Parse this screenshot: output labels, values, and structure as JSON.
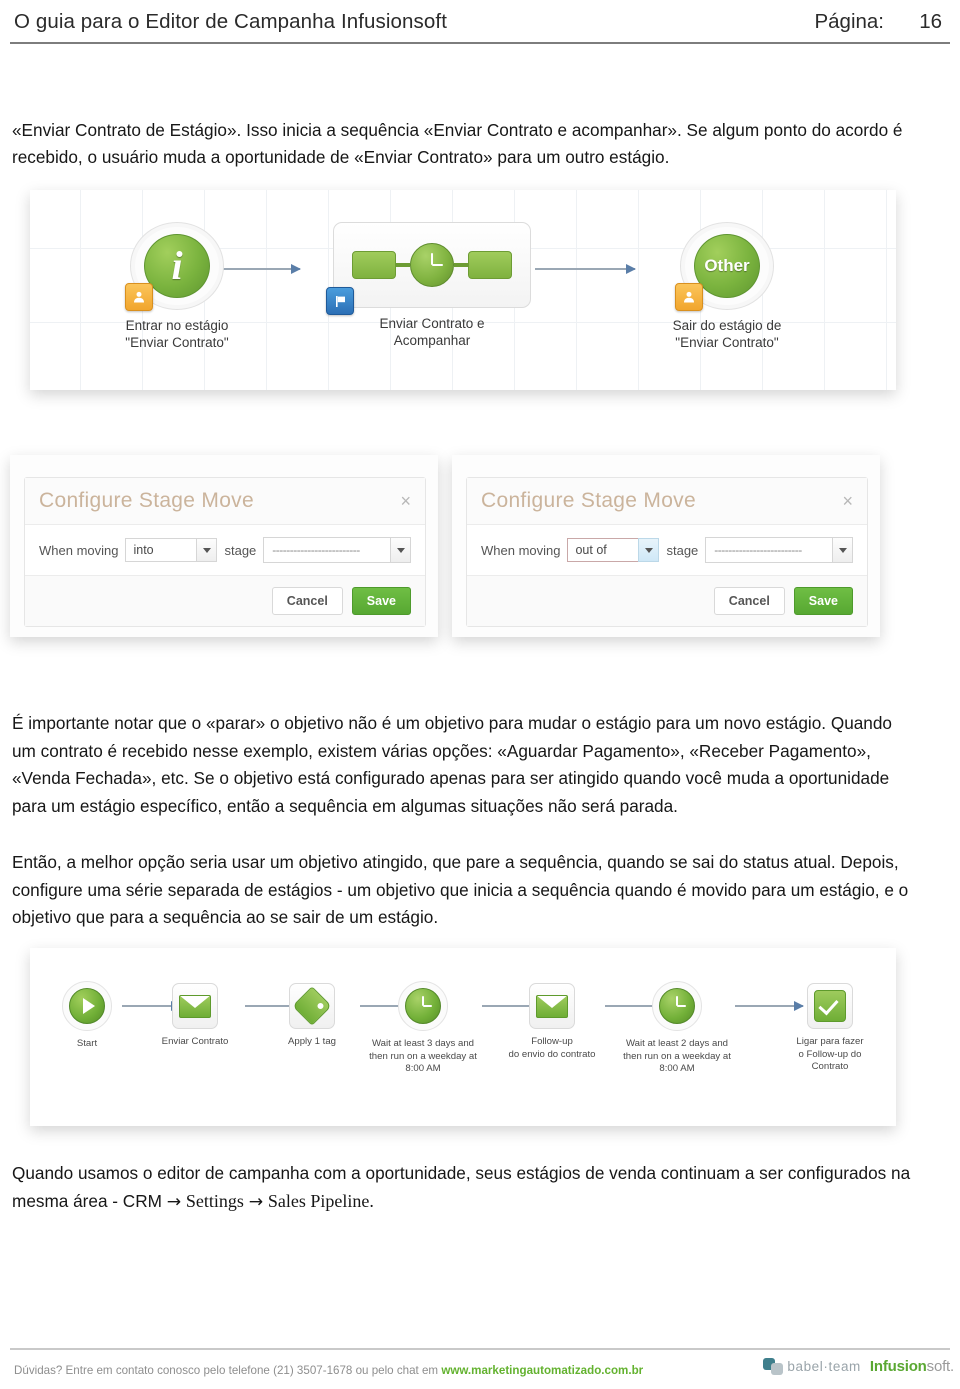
{
  "header": {
    "title": "O guia para o Editor de Campanha Infusionsoft",
    "page_label": "Página:",
    "page_number": "16"
  },
  "content": {
    "intro_paragraph": "«Enviar Contrato de Estágio». Isso inicia a sequência «Enviar Contrato e acompanhar». Se algum ponto do acordo é recebido, o usuário muda a oportunidade de «Enviar Contrato» para um outro estágio.",
    "paragraph_1": "É importante notar que o «parar» o objetivo não é um objetivo para mudar o estágio para um novo estágio. Quando um contrato é recebido nesse exemplo, existem várias opções: «Aguardar Pagamento», «Receber Pagamento», «Venda Fechada», etc. Se o objetivo está configurado apenas para ser atingido quando você muda a oportunidade para um estágio específico, então a sequência em algumas situações não será parada.",
    "paragraph_2": "Então, a melhor opção seria usar um objetivo atingido, que pare a sequência, quando se sai do status atual. Depois, configure uma série separada de estágios - um objetivo que inicia a sequência quando é movido para um estágio, e o objetivo que para a sequência ao se sair de um estágio.",
    "closing_lead": "Quando usamos o editor de campanha com a oportunidade, seus estágios de venda continuam a ser configurados na mesma área - CRM ",
    "closing_arrow_1": "→",
    "closing_settings": "Settings",
    "closing_arrow_2": "→",
    "closing_pipeline": "Sales Pipeline",
    "closing_period": "."
  },
  "figure_stage_flow": {
    "nodes": [
      {
        "caption": "Entrar no estágio\n\"Enviar Contrato\"",
        "icon": "info-goal-icon",
        "badge": "contact-badge-icon",
        "glyph": "i"
      },
      {
        "caption": "Enviar Contrato e\nAcompanhar",
        "icon": "sequence-clock-icon",
        "badge": "flag-badge-icon",
        "glyph": ""
      },
      {
        "caption": "Sair do estágio de\n\"Enviar Contrato\"",
        "icon": "other-goal-icon",
        "badge": "contact-badge-icon",
        "glyph": "Other"
      }
    ]
  },
  "dialogs": [
    {
      "title": "Configure Stage Move",
      "close_label": "×",
      "label_when_moving": "When moving",
      "direction_value": "into",
      "label_stage": "stage",
      "stage_value": "-------------------------",
      "cancel_label": "Cancel",
      "save_label": "Save",
      "focused": false
    },
    {
      "title": "Configure Stage Move",
      "close_label": "×",
      "label_when_moving": "When moving",
      "direction_value": "out of",
      "label_stage": "stage",
      "stage_value": "-------------------------",
      "cancel_label": "Cancel",
      "save_label": "Save",
      "focused": true
    }
  ],
  "figure_sequence_flow": {
    "steps": [
      {
        "caption": "Start",
        "icon": "play-icon",
        "shape": "round"
      },
      {
        "caption": "Enviar Contrato",
        "icon": "email-icon",
        "shape": "square"
      },
      {
        "caption": "Apply 1 tag",
        "icon": "tag-icon",
        "shape": "square"
      },
      {
        "caption": "Wait at least 3 days  and\nthen run on a weekday  at\n8:00 AM",
        "icon": "clock-icon",
        "shape": "round"
      },
      {
        "caption": "Follow-up\ndo envio do contrato",
        "icon": "email-icon",
        "shape": "square"
      },
      {
        "caption": "Wait at least 2 days  and\nthen run on a weekday  at\n8:00 AM",
        "icon": "clock-icon",
        "shape": "round"
      },
      {
        "caption": "Ligar para fazer\no Follow-up do\nContrato",
        "icon": "check-icon",
        "shape": "square"
      }
    ]
  },
  "footer": {
    "text_before_url": "Dúvidas? Entre em contato conosco pelo telefone (21) 3507-1678 ou pelo chat em ",
    "url": "www.marketingautomatizado.com.br",
    "logo_babel": "babel·team",
    "logo_infusion_bold": "Infusion",
    "logo_infusion_light": "soft."
  },
  "colors": {
    "accent_green": "#63b22f",
    "dialog_title": "#cbb49c",
    "header_rule": "#7d7d7d"
  }
}
